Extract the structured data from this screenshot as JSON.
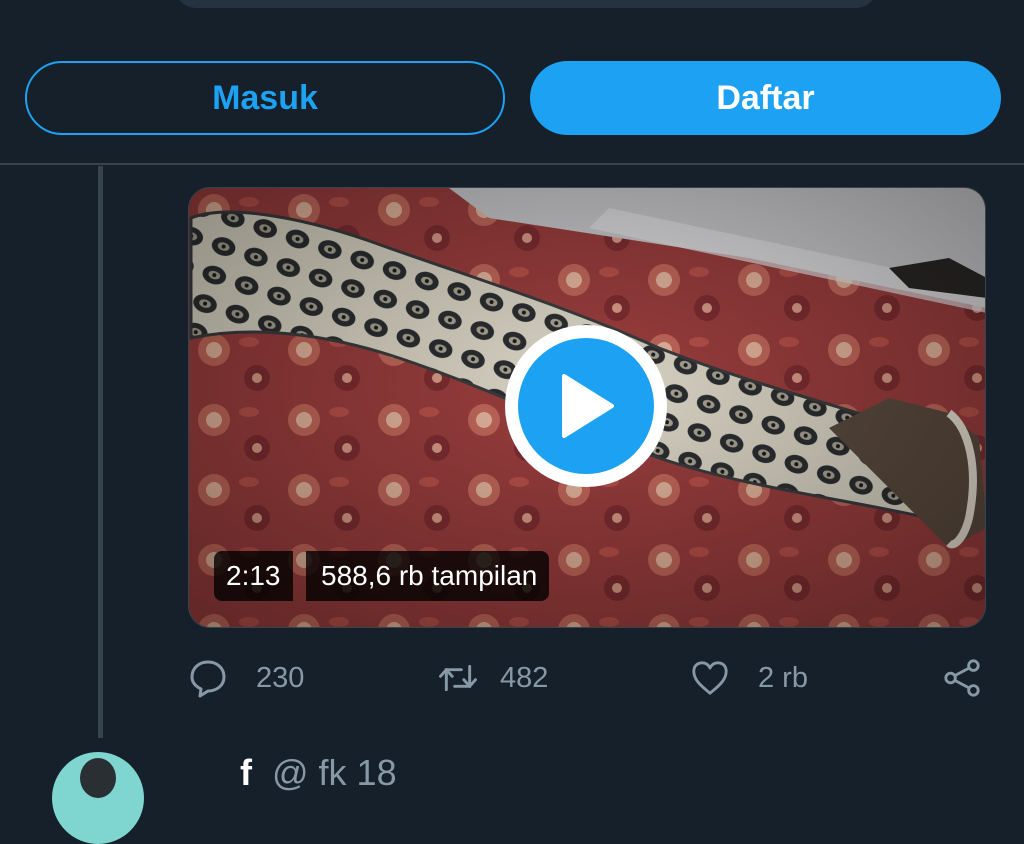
{
  "auth": {
    "login_label": "Masuk",
    "signup_label": "Daftar"
  },
  "video": {
    "duration": "2:13",
    "views": "588,6 rb tampilan",
    "play_icon": "play-icon"
  },
  "actions": {
    "reply_count": "230",
    "retweet_count": "482",
    "like_count": "2 rb",
    "icons": [
      "reply-icon",
      "retweet-icon",
      "like-icon",
      "share-icon"
    ]
  },
  "next_tweet": {
    "name": "f",
    "handle": "@ fk 18"
  },
  "colors": {
    "background": "#15202b",
    "accent": "#1da1f2",
    "muted": "#8899a6",
    "border": "#38444d"
  }
}
